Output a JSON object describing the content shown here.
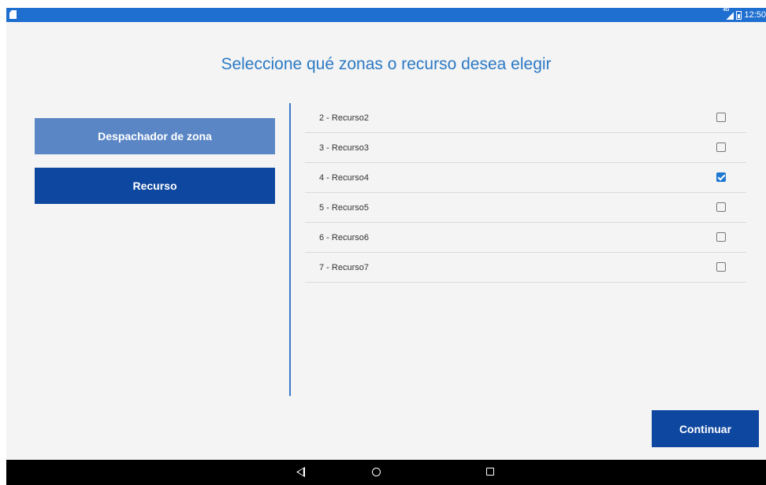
{
  "status_bar": {
    "time": "12:50",
    "signal_label": "4G",
    "color": "#1f6fd1"
  },
  "title": "Seleccione qué zonas o recurso desea elegir",
  "buttons": {
    "zone_dispatcher": "Despachador de zona",
    "resource": "Recurso",
    "continue": "Continuar"
  },
  "resources": [
    {
      "label": "2 - Recurso2",
      "checked": false
    },
    {
      "label": "3 - Recurso3",
      "checked": false
    },
    {
      "label": "4 - Recurso4",
      "checked": true
    },
    {
      "label": "5 - Recurso5",
      "checked": false
    },
    {
      "label": "6 - Recurso6",
      "checked": false
    },
    {
      "label": "7 - Recurso7",
      "checked": false
    }
  ],
  "colors": {
    "accent": "#0e47a0",
    "accent_light": "#5a86c5",
    "title": "#2b79c4",
    "checkbox_checked": "#1f78d1"
  },
  "nav_icons": [
    "back-icon",
    "home-icon",
    "recent-apps-icon"
  ]
}
